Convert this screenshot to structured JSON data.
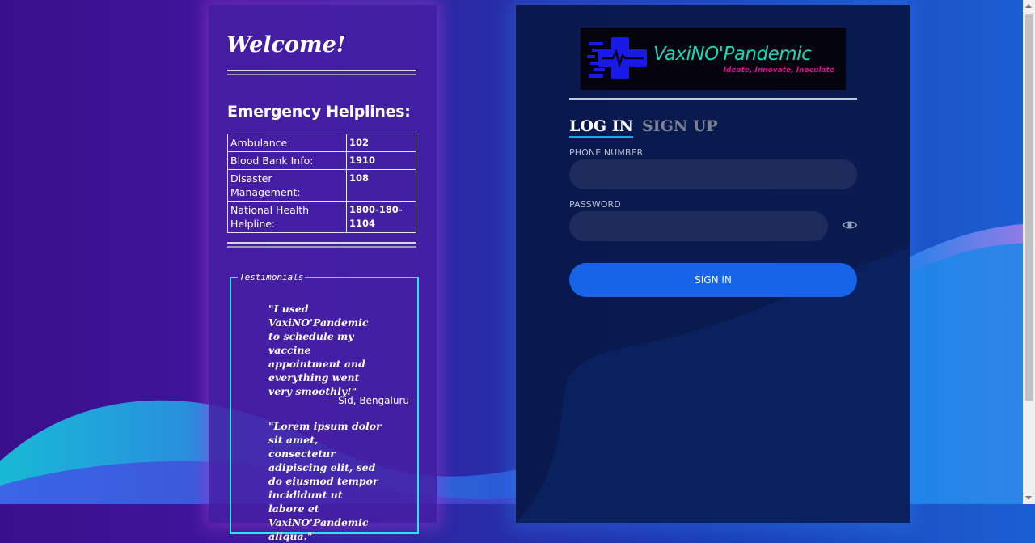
{
  "left_panel": {
    "welcome": "Welcome!",
    "helplines_title": "Emergency Helplines:",
    "helplines": [
      {
        "label": "Ambulance:",
        "value": "102"
      },
      {
        "label": "Blood Bank Info:",
        "value": "1910"
      },
      {
        "label": "Disaster Management:",
        "value": "108"
      },
      {
        "label": "National Health Helpline:",
        "value": "1800-180-1104"
      }
    ],
    "testimonials": {
      "legend": "Testimonials",
      "items": [
        {
          "quote": "\"I used VaxiNO'Pandemic to schedule my vaccine appointment and everything went very smoothly!\"",
          "author": "— Sid, Bengaluru"
        },
        {
          "quote": "\"Lorem ipsum dolor sit amet, consectetur adipiscing elit, sed do eiusmod tempor incididunt ut labore et VaxiNO'Pandemic aliqua.\""
        }
      ]
    }
  },
  "logo": {
    "name": "VaxiNO'Pandemic",
    "tagline": "Ideate, Innovate, Inoculate"
  },
  "auth": {
    "tabs": {
      "login": "LOG IN",
      "signup": "SIGN UP"
    },
    "phone_label": "PHONE NUMBER",
    "phone_value": "",
    "password_label": "PASSWORD",
    "password_value": "",
    "signin_label": "SIGN IN"
  },
  "colors": {
    "accent": "#1764e8",
    "logo_text": "#1ad6b4",
    "logo_tagline": "#d4148a",
    "testimonial_border": "#2ee6ef"
  },
  "icons": {
    "show_password": "eye-icon",
    "logo": "medical-cross-pulse-icon"
  }
}
